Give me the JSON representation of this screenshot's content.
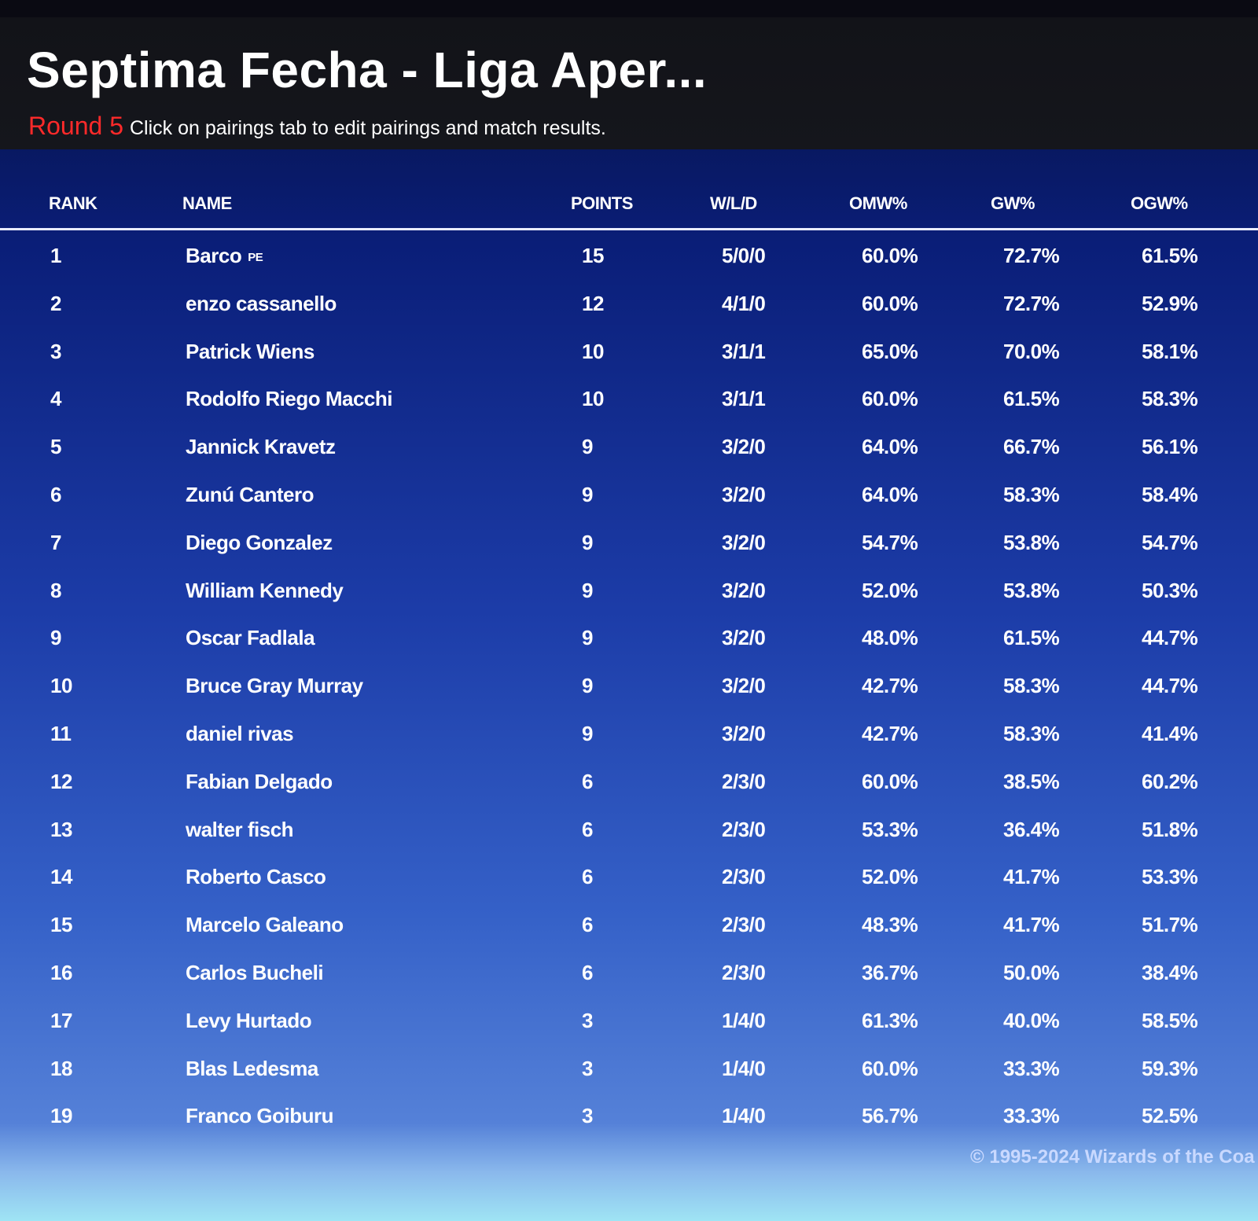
{
  "header": {
    "title": "Septima Fecha - Liga Aper...",
    "round_label": "Round 5",
    "instructions": "Click on pairings tab to edit pairings and match results."
  },
  "table": {
    "columns": [
      "RANK",
      "NAME",
      "POINTS",
      "W/L/D",
      "OMW%",
      "GW%",
      "OGW%"
    ],
    "rows": [
      {
        "rank": "1",
        "name": "Barco",
        "flag": "PE",
        "points": "15",
        "wld": "5/0/0",
        "omw": "60.0%",
        "gw": "72.7%",
        "ogw": "61.5%"
      },
      {
        "rank": "2",
        "name": "enzo cassanello",
        "flag": "",
        "points": "12",
        "wld": "4/1/0",
        "omw": "60.0%",
        "gw": "72.7%",
        "ogw": "52.9%"
      },
      {
        "rank": "3",
        "name": "Patrick Wiens",
        "flag": "",
        "points": "10",
        "wld": "3/1/1",
        "omw": "65.0%",
        "gw": "70.0%",
        "ogw": "58.1%"
      },
      {
        "rank": "4",
        "name": "Rodolfo Riego Macchi",
        "flag": "",
        "points": "10",
        "wld": "3/1/1",
        "omw": "60.0%",
        "gw": "61.5%",
        "ogw": "58.3%"
      },
      {
        "rank": "5",
        "name": "Jannick Kravetz",
        "flag": "",
        "points": "9",
        "wld": "3/2/0",
        "omw": "64.0%",
        "gw": "66.7%",
        "ogw": "56.1%"
      },
      {
        "rank": "6",
        "name": "Zunú Cantero",
        "flag": "",
        "points": "9",
        "wld": "3/2/0",
        "omw": "64.0%",
        "gw": "58.3%",
        "ogw": "58.4%"
      },
      {
        "rank": "7",
        "name": "Diego Gonzalez",
        "flag": "",
        "points": "9",
        "wld": "3/2/0",
        "omw": "54.7%",
        "gw": "53.8%",
        "ogw": "54.7%"
      },
      {
        "rank": "8",
        "name": "William Kennedy",
        "flag": "",
        "points": "9",
        "wld": "3/2/0",
        "omw": "52.0%",
        "gw": "53.8%",
        "ogw": "50.3%"
      },
      {
        "rank": "9",
        "name": "Oscar Fadlala",
        "flag": "",
        "points": "9",
        "wld": "3/2/0",
        "omw": "48.0%",
        "gw": "61.5%",
        "ogw": "44.7%"
      },
      {
        "rank": "10",
        "name": "Bruce Gray Murray",
        "flag": "",
        "points": "9",
        "wld": "3/2/0",
        "omw": "42.7%",
        "gw": "58.3%",
        "ogw": "44.7%"
      },
      {
        "rank": "11",
        "name": "daniel rivas",
        "flag": "",
        "points": "9",
        "wld": "3/2/0",
        "omw": "42.7%",
        "gw": "58.3%",
        "ogw": "41.4%"
      },
      {
        "rank": "12",
        "name": "Fabian Delgado",
        "flag": "",
        "points": "6",
        "wld": "2/3/0",
        "omw": "60.0%",
        "gw": "38.5%",
        "ogw": "60.2%"
      },
      {
        "rank": "13",
        "name": "walter fisch",
        "flag": "",
        "points": "6",
        "wld": "2/3/0",
        "omw": "53.3%",
        "gw": "36.4%",
        "ogw": "51.8%"
      },
      {
        "rank": "14",
        "name": "Roberto Casco",
        "flag": "",
        "points": "6",
        "wld": "2/3/0",
        "omw": "52.0%",
        "gw": "41.7%",
        "ogw": "53.3%"
      },
      {
        "rank": "15",
        "name": "Marcelo Galeano",
        "flag": "",
        "points": "6",
        "wld": "2/3/0",
        "omw": "48.3%",
        "gw": "41.7%",
        "ogw": "51.7%"
      },
      {
        "rank": "16",
        "name": "Carlos Bucheli",
        "flag": "",
        "points": "6",
        "wld": "2/3/0",
        "omw": "36.7%",
        "gw": "50.0%",
        "ogw": "38.4%"
      },
      {
        "rank": "17",
        "name": "Levy Hurtado",
        "flag": "",
        "points": "3",
        "wld": "1/4/0",
        "omw": "61.3%",
        "gw": "40.0%",
        "ogw": "58.5%"
      },
      {
        "rank": "18",
        "name": "Blas Ledesma",
        "flag": "",
        "points": "3",
        "wld": "1/4/0",
        "omw": "60.0%",
        "gw": "33.3%",
        "ogw": "59.3%"
      },
      {
        "rank": "19",
        "name": "Franco Goiburu",
        "flag": "",
        "points": "3",
        "wld": "1/4/0",
        "omw": "56.7%",
        "gw": "33.3%",
        "ogw": "52.5%"
      }
    ]
  },
  "footer": {
    "copyright": "© 1995-2024 Wizards of the Coa"
  },
  "colors": {
    "round_label": "#ff2a2a",
    "header_bg": "#15161c",
    "table_bg_top": "#0a1e78",
    "table_bg_bottom": "#5581d8",
    "text": "#ffffff"
  }
}
